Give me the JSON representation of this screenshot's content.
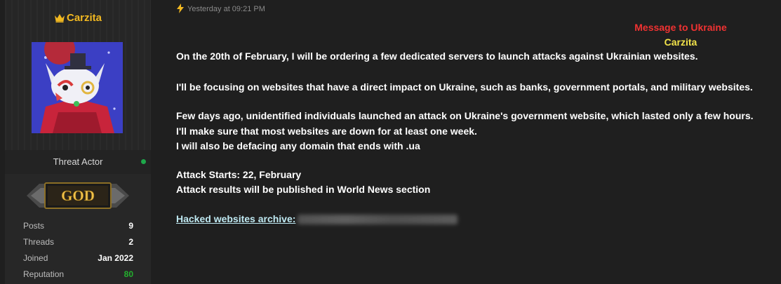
{
  "user": {
    "name": "Carzita",
    "role": "Threat Actor",
    "rank": "GOD",
    "stats": [
      {
        "label": "Posts",
        "value": "9"
      },
      {
        "label": "Threads",
        "value": "2"
      },
      {
        "label": "Joined",
        "value": "Jan 2022"
      },
      {
        "label": "Reputation",
        "value": "80"
      }
    ]
  },
  "post": {
    "timestamp": "Yesterday at 09:21 PM",
    "title_line1": "Message to Ukraine",
    "title_line2": "Carzita",
    "lines": [
      "On the 20th of February, I will be ordering a few dedicated servers to launch attacks against Ukrainian websites.",
      "I'll be focusing on websites that have a direct impact on Ukraine, such as banks, government portals, and military websites.",
      "Few days ago, unidentified individuals launched an attack on Ukraine's government website, which lasted only a few hours.",
      "I'll make sure that most websites are down for at least one week.",
      "I will also be defacing any domain that ends with .ua",
      "Attack Starts: 22, February",
      "Attack results will be published in World News section"
    ],
    "archive_link_label": "Hacked websites archive:"
  },
  "colors": {
    "username": "#f1b821",
    "title_red": "#f03232",
    "title_yellow": "#f2e34a",
    "reputation": "#23b02d",
    "online": "#1ea84a"
  }
}
